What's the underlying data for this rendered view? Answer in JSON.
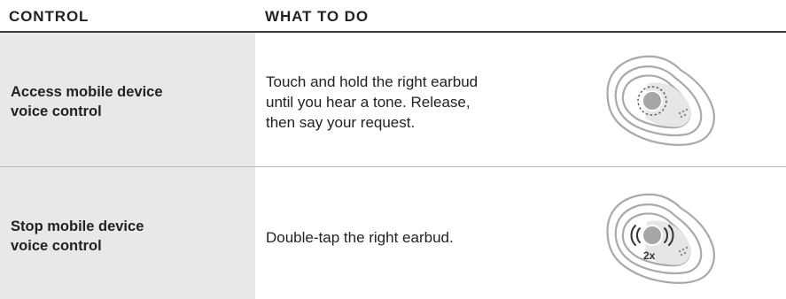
{
  "table": {
    "headers": {
      "control": "CONTROL",
      "what_to_do": "WHAT TO DO"
    },
    "rows": [
      {
        "control_lines": [
          "Access mobile device",
          "voice control"
        ],
        "instruction_lines": [
          "Touch and hold the right earbud",
          "until you hear a tone. Release,",
          "then say your request."
        ],
        "illustration": "earbud-touch-hold-icon"
      },
      {
        "control_lines": [
          "Stop mobile device",
          "voice control"
        ],
        "instruction_lines": [
          "Double-tap the right earbud."
        ],
        "illustration": "earbud-double-tap-icon",
        "illustration_label": "2x"
      }
    ]
  },
  "colors": {
    "control_cell_bg": "#e8e8e8",
    "text": "#222222",
    "earbud_outline": "#a9a9a9",
    "touch_dot": "#a6a6a6"
  }
}
